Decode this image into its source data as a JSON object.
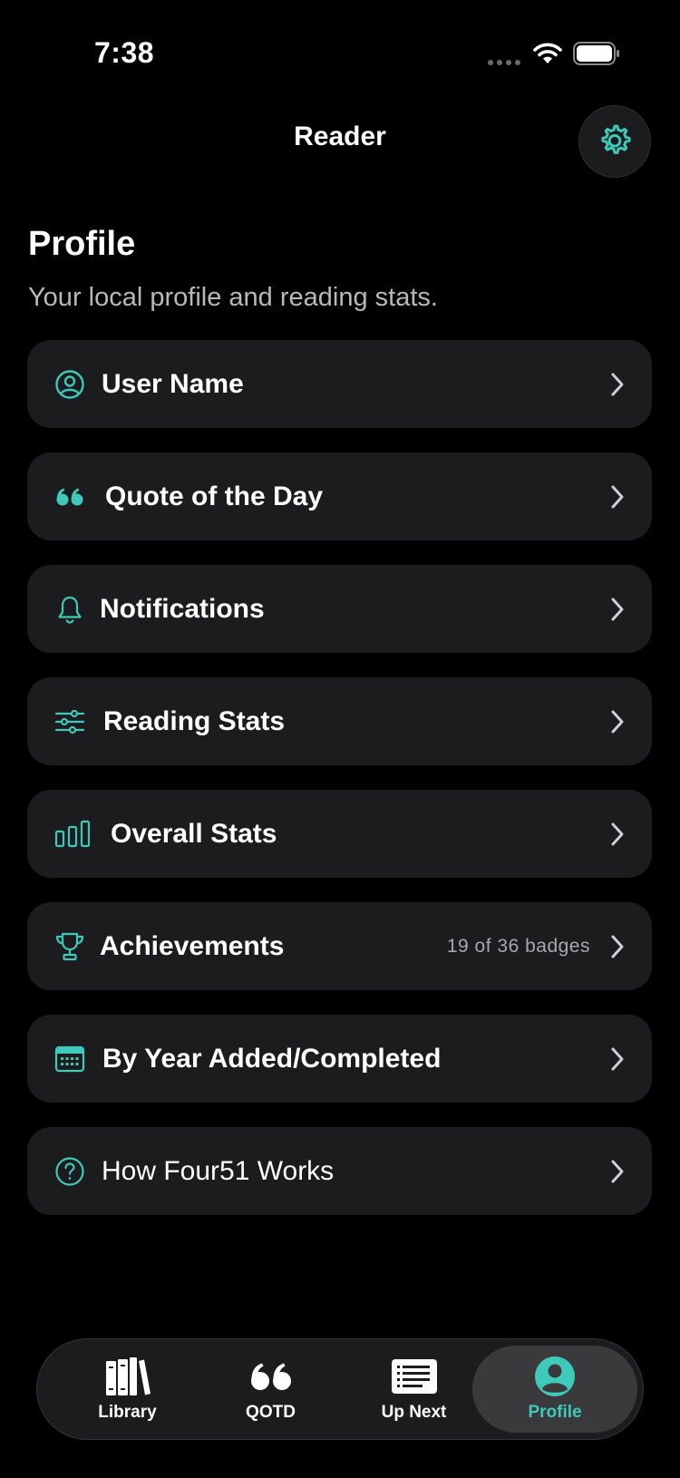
{
  "status_bar": {
    "time": "7:38"
  },
  "nav": {
    "title": "Reader"
  },
  "header": {
    "title": "Profile",
    "subtitle": "Your local profile and reading stats."
  },
  "menu": {
    "items": [
      {
        "label": "User Name",
        "icon": "person-circle-icon"
      },
      {
        "label": "Quote of the Day",
        "icon": "quote-icon"
      },
      {
        "label": "Notifications",
        "icon": "bell-icon"
      },
      {
        "label": "Reading Stats",
        "icon": "sliders-icon"
      },
      {
        "label": "Overall Stats",
        "icon": "bar-chart-icon"
      },
      {
        "label": "Achievements",
        "icon": "trophy-icon",
        "detail": "19 of 36 badges"
      },
      {
        "label": "By Year Added/Completed",
        "icon": "calendar-icon"
      },
      {
        "label": "How Four51 Works",
        "icon": "question-circle-icon"
      }
    ]
  },
  "tab_bar": {
    "tabs": [
      {
        "label": "Library",
        "icon": "books-icon"
      },
      {
        "label": "QOTD",
        "icon": "quote-icon"
      },
      {
        "label": "Up Next",
        "icon": "list-icon"
      },
      {
        "label": "Profile",
        "icon": "person-circle-icon",
        "active": true
      }
    ]
  },
  "colors": {
    "accent": "#3ec9b9",
    "background": "#000000",
    "card": "#1c1c1e",
    "secondary_text": "#b8b8bc"
  }
}
